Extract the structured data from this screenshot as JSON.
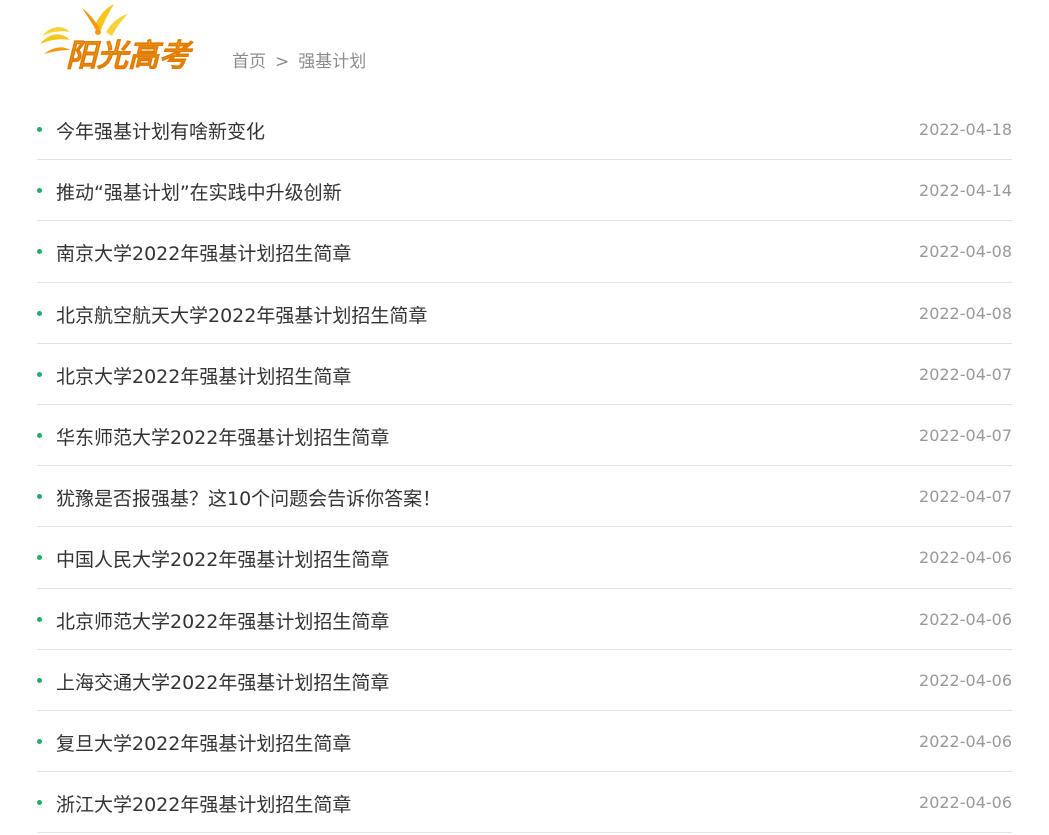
{
  "header": {
    "logo_text": "阳光高考",
    "breadcrumb": {
      "home": "首页",
      "separator": ">",
      "current": "强基计划"
    }
  },
  "colors": {
    "bullet": "#1fae6a",
    "logo_orange": "#f08a0c",
    "logo_yellow": "#f7c61c"
  },
  "articles": [
    {
      "title": "今年强基计划有啥新变化",
      "date": "2022-04-18"
    },
    {
      "title": "推动“强基计划”在实践中升级创新",
      "date": "2022-04-14"
    },
    {
      "title": "南京大学2022年强基计划招生简章",
      "date": "2022-04-08"
    },
    {
      "title": "北京航空航天大学2022年强基计划招生简章",
      "date": "2022-04-08"
    },
    {
      "title": "北京大学2022年强基计划招生简章",
      "date": "2022-04-07"
    },
    {
      "title": "华东师范大学2022年强基计划招生简章",
      "date": "2022-04-07"
    },
    {
      "title": "犹豫是否报强基？这10个问题会告诉你答案！",
      "date": "2022-04-07"
    },
    {
      "title": "中国人民大学2022年强基计划招生简章",
      "date": "2022-04-06"
    },
    {
      "title": "北京师范大学2022年强基计划招生简章",
      "date": "2022-04-06"
    },
    {
      "title": "上海交通大学2022年强基计划招生简章",
      "date": "2022-04-06"
    },
    {
      "title": "复旦大学2022年强基计划招生简章",
      "date": "2022-04-06"
    },
    {
      "title": "浙江大学2022年强基计划招生简章",
      "date": "2022-04-06"
    }
  ]
}
